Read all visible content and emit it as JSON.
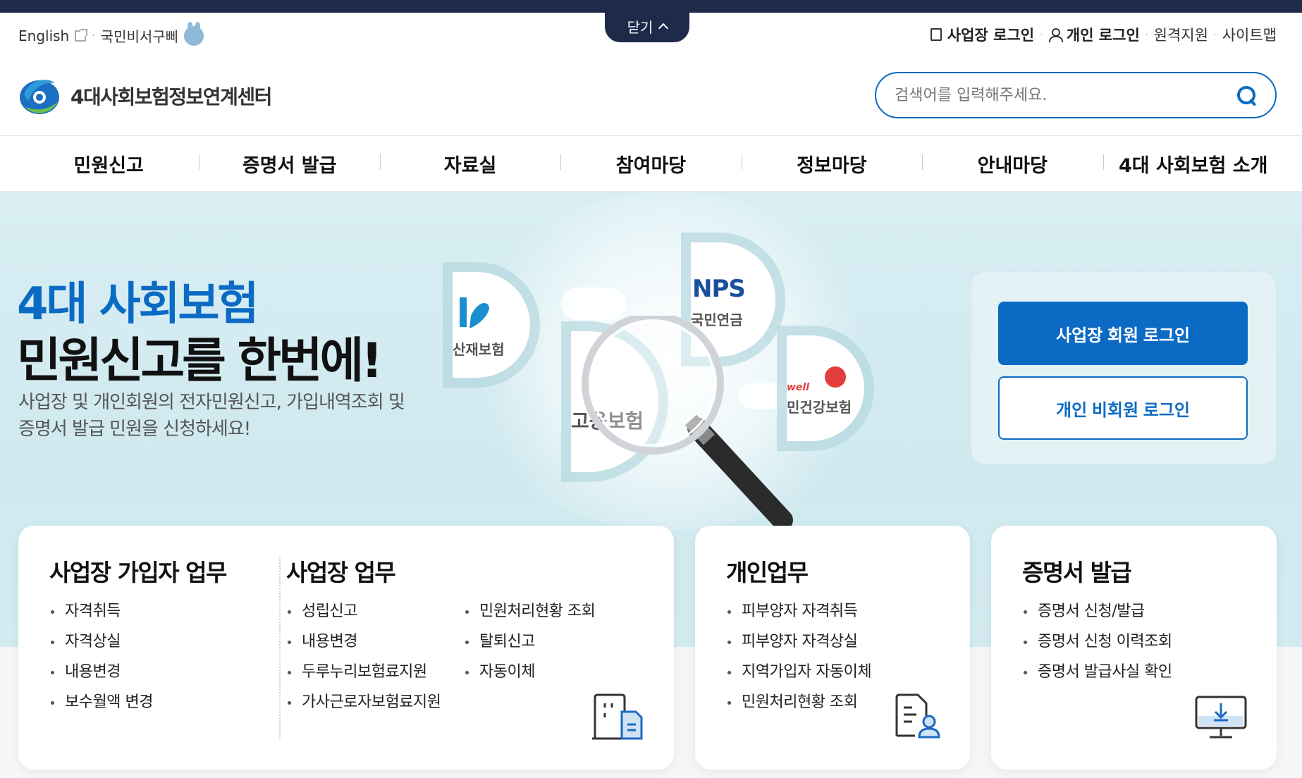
{
  "top_tab": {
    "close_label": "닫기"
  },
  "util_left": {
    "english": "English",
    "secretary": "국민비서구삐"
  },
  "util_right": {
    "biz_login": "사업장 로그인",
    "personal_login": "개인 로그인",
    "remote_support": "원격지원",
    "sitemap": "사이트맵"
  },
  "logo": {
    "text": "4대사회보험정보연계센터"
  },
  "search": {
    "placeholder": "검색어를 입력해주세요."
  },
  "gnb": [
    "민원신고",
    "증명서 발급",
    "자료실",
    "참여마당",
    "정보마당",
    "안내마당",
    "4대 사회보험 소개"
  ],
  "hero": {
    "title_line1": "4대 사회보험",
    "title_line2": "민원신고를 한번에!",
    "desc_line1": "사업장 및 개인회원의 전자민원신고, 가입내역조회 및",
    "desc_line2": "증명서 발급 민원을 신청하세요!",
    "bubbles": {
      "sanjae": "산재보험",
      "nps_logo": "NPS",
      "nps_name": "국민연금",
      "goyong": "고용보험",
      "health": "민건강보험",
      "well": "well"
    }
  },
  "login": {
    "biz_member": "사업장 회원 로그인",
    "personal_nonmember": "개인 비회원 로그인"
  },
  "cards": {
    "biz_subscriber": {
      "title": "사업장 가입자 업무",
      "items": [
        "자격취득",
        "자격상실",
        "내용변경",
        "보수월액 변경"
      ]
    },
    "biz": {
      "title": "사업장 업무",
      "col1": [
        "성립신고",
        "내용변경",
        "두루누리보험료지원",
        "가사근로자보험료지원"
      ],
      "col2": [
        "민원처리현황 조회",
        "탈퇴신고",
        "자동이체"
      ]
    },
    "personal": {
      "title": "개인업무",
      "items": [
        "피부양자 자격취득",
        "피부양자 자격상실",
        "지역가입자 자동이체",
        "민원처리현황 조회"
      ]
    },
    "cert": {
      "title": "증명서 발급",
      "items": [
        "증명서 신청/발급",
        "증명서 신청 이력조회",
        "증명서 발급사실 확인"
      ]
    }
  },
  "colors": {
    "primary": "#0b6ac4",
    "navy": "#1e2a4a",
    "hero_bg": "#d8eef3"
  }
}
